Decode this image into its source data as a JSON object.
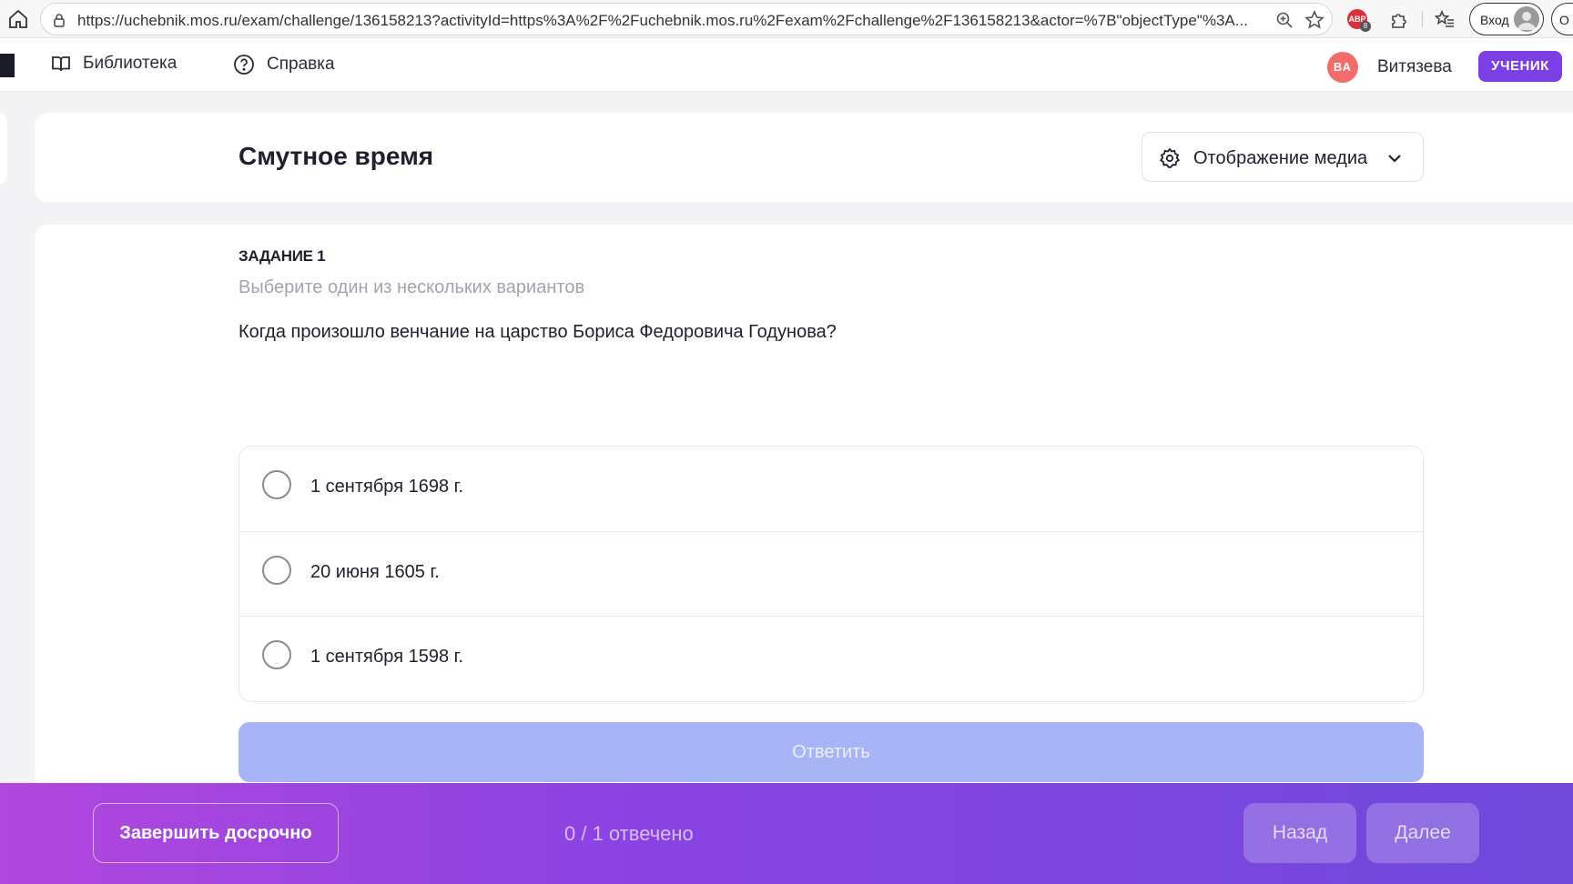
{
  "browser": {
    "url": "https://uchebnik.mos.ru/exam/challenge/136158213?activityId=https%3A%2F%2Fuchebnik.mos.ru%2Fexam%2Fchallenge%2F136158213&actor=%7B\"objectType\"%3A...",
    "extension_badge_text": "ABP",
    "extension_badge_count": "8",
    "login_label": "Вход",
    "cut_button_label": "О"
  },
  "header": {
    "nav": [
      {
        "label": "Библиотека",
        "icon": "book-icon"
      },
      {
        "label": "Справка",
        "icon": "help-circle-icon"
      }
    ],
    "user_initials": "ВА",
    "user_name": "Витязева",
    "role": "УЧЕНИК"
  },
  "page": {
    "title": "Смутное время",
    "media_button": "Отображение медиа"
  },
  "task": {
    "label": "ЗАДАНИЕ 1",
    "hint": "Выберите один из нескольких вариантов",
    "question": "Когда произошло венчание на царство Бориса Федоровича Годунова?",
    "options": [
      "1 сентября 1698 г.",
      "20 июня 1605 г.",
      "1 сентября 1598 г."
    ],
    "answer_button": "Ответить"
  },
  "footer": {
    "finish_button": "Завершить досрочно",
    "progress": "0 / 1 отвечено",
    "back_button": "Назад",
    "next_button": "Далее"
  },
  "colors": {
    "accent": "#7b3fe4",
    "answer_disabled": "#a7b4f6",
    "avatar": "#f36c6c"
  }
}
